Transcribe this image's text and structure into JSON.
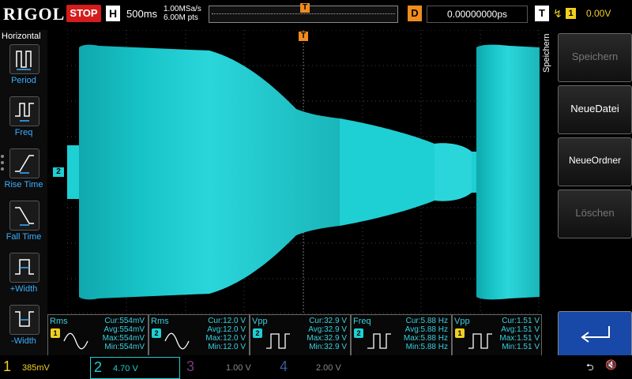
{
  "topbar": {
    "logo": "RIGOL",
    "run_state": "STOP",
    "timebase_label": "H",
    "timebase": "500ms",
    "sample_rate": "1.00MSa/s",
    "memory_depth": "6.00M pts",
    "trigger_marker": "T",
    "delay_label": "D",
    "delay_value": "0.00000000ps",
    "trigger_label": "T",
    "trigger_edge_icon": "rising-edge-icon",
    "trigger_source": "1",
    "trigger_level": "0.00V"
  },
  "left_panel": {
    "title": "Horizontal",
    "items": [
      {
        "label": "Period",
        "icon": "period-icon"
      },
      {
        "label": "Freq",
        "icon": "freq-icon"
      },
      {
        "label": "Rise Time",
        "icon": "rise-time-icon"
      },
      {
        "label": "Fall Time",
        "icon": "fall-time-icon"
      },
      {
        "label": "+Width",
        "icon": "pos-width-icon"
      },
      {
        "label": "-Width",
        "icon": "neg-width-icon"
      }
    ]
  },
  "waveform": {
    "channel_marker": "2",
    "trigger_level_marker": "T",
    "trace_color": "#1ecfd3"
  },
  "right_panel": {
    "title": "Speichern",
    "buttons": [
      {
        "label": "Speichern",
        "enabled": false
      },
      {
        "label": "NeueDatei",
        "enabled": true
      },
      {
        "label": "NeueOrdner",
        "enabled": true
      },
      {
        "label": "Löschen",
        "enabled": false
      }
    ],
    "enter_icon": "enter-icon"
  },
  "measurements": [
    {
      "name": "Rms",
      "channel": "1",
      "channel_color": "#f0d020",
      "cur": "Cur:554mV",
      "avg": "Avg:554mV",
      "max": "Max:554mV",
      "min": "Min:554mV",
      "icon": "sine-wave-icon"
    },
    {
      "name": "Rms",
      "channel": "2",
      "channel_color": "#1ecfd3",
      "cur": "Cur:12.0 V",
      "avg": "Avg:12.0 V",
      "max": "Max:12.0 V",
      "min": "Min:12.0 V",
      "icon": "sine-wave-icon"
    },
    {
      "name": "Vpp",
      "channel": "2",
      "channel_color": "#1ecfd3",
      "cur": "Cur:32.9 V",
      "avg": "Avg:32.9 V",
      "max": "Max:32.9 V",
      "min": "Min:32.9 V",
      "icon": "square-wave-icon"
    },
    {
      "name": "Freq",
      "channel": "2",
      "channel_color": "#1ecfd3",
      "cur": "Cur:5.88 Hz",
      "avg": "Avg:5.88 Hz",
      "max": "Max:5.88 Hz",
      "min": "Min:5.88 Hz",
      "icon": "pulse-icon"
    },
    {
      "name": "Vpp",
      "channel": "1",
      "channel_color": "#f0d020",
      "cur": "Cur:1.51 V",
      "avg": "Avg:1.51 V",
      "max": "Max:1.51 V",
      "min": "Min:1.51 V",
      "icon": "square-wave-icon"
    }
  ],
  "bottombar": {
    "channels": [
      {
        "num": "1",
        "value": "385mV",
        "color": "#f0d020"
      },
      {
        "num": "2",
        "value": "4.70 V",
        "color": "#1ecfd3"
      },
      {
        "num": "3",
        "value": "1.00 V",
        "color": "#b040c0"
      },
      {
        "num": "4",
        "value": "2.00 V",
        "color": "#3a78ff"
      }
    ],
    "usb_icon": "usb-icon",
    "sound_icon": "mute-icon"
  }
}
